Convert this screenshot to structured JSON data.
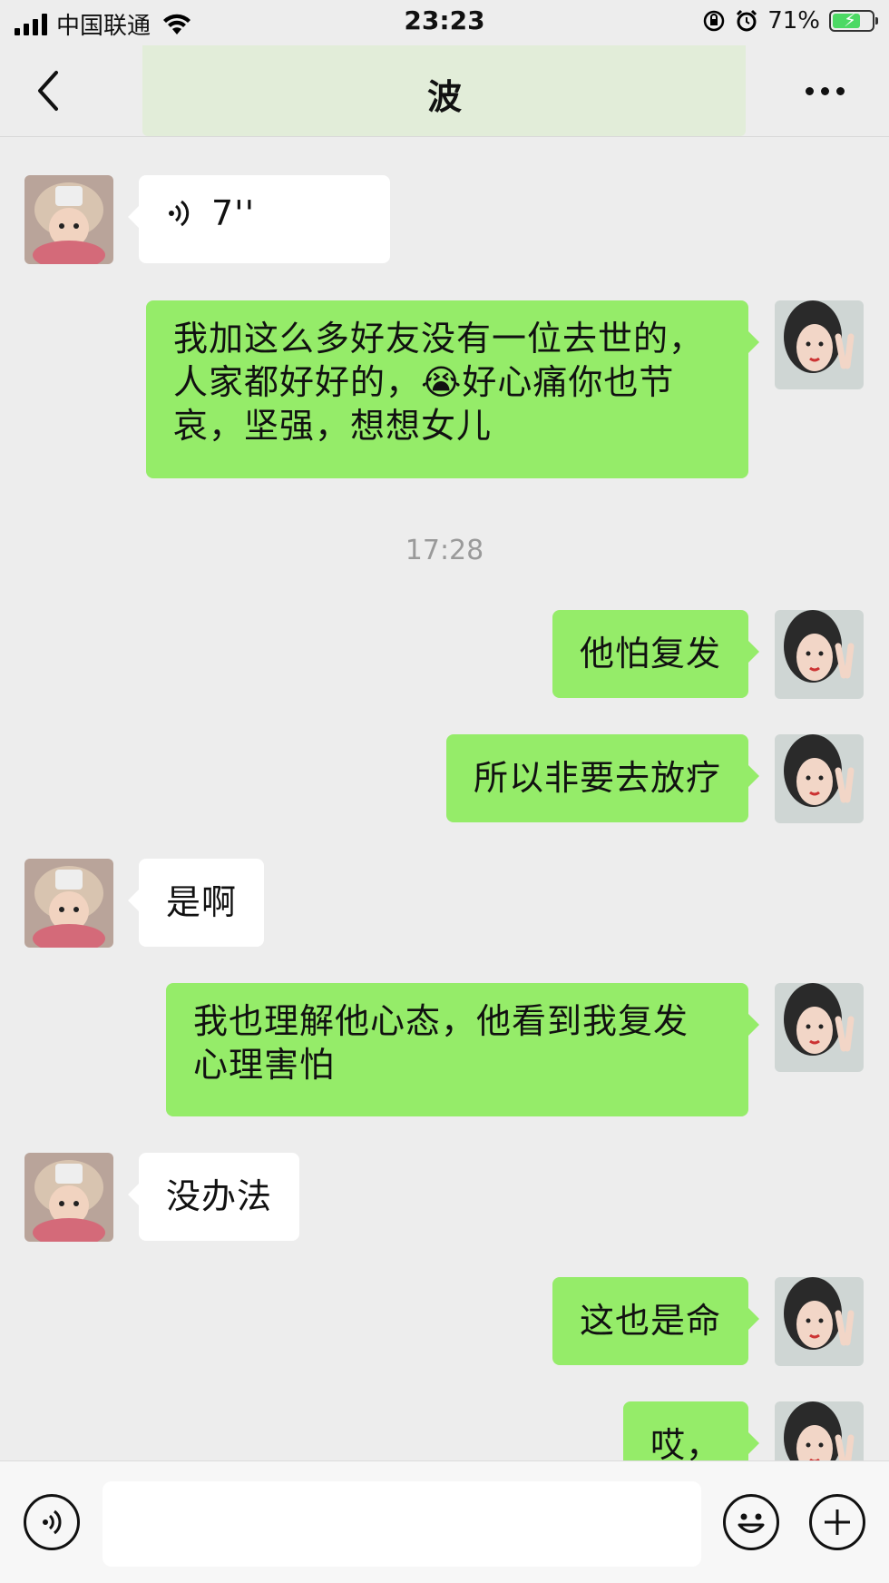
{
  "status_bar": {
    "carrier": "中国联通",
    "time": "23:23",
    "battery_percent": "71%",
    "battery_level": 0.71
  },
  "nav": {
    "title": "波",
    "back_icon": "chevron-left-icon",
    "more_icon": "more-dots-icon"
  },
  "chat": {
    "voice": {
      "duration": "7''",
      "icon": "voice-wave-icon"
    },
    "msg1": {
      "line1": "我加这么多好友没有一位去世的，",
      "line2_a": "人家都好好的，",
      "emoji": "😭",
      "line2_b": "好心痛你也节",
      "line3": "哀，坚强，想想女儿"
    },
    "time_separator": "17:28",
    "msg2": "他怕复发",
    "msg3": "所以非要去放疗",
    "msg4": "是啊",
    "msg5": {
      "line1": "我也理解他心态，他看到我复发",
      "line2": "心理害怕"
    },
    "msg6": "没办法",
    "msg7": "这也是命",
    "msg8": "哎，"
  },
  "input_bar": {
    "voice_icon": "voice-input-icon",
    "emoji_icon": "emoji-icon",
    "plus_icon": "plus-icon",
    "text_value": ""
  },
  "colors": {
    "background": "#ededed",
    "outgoing_bubble": "#95ec69",
    "incoming_bubble": "#ffffff"
  }
}
